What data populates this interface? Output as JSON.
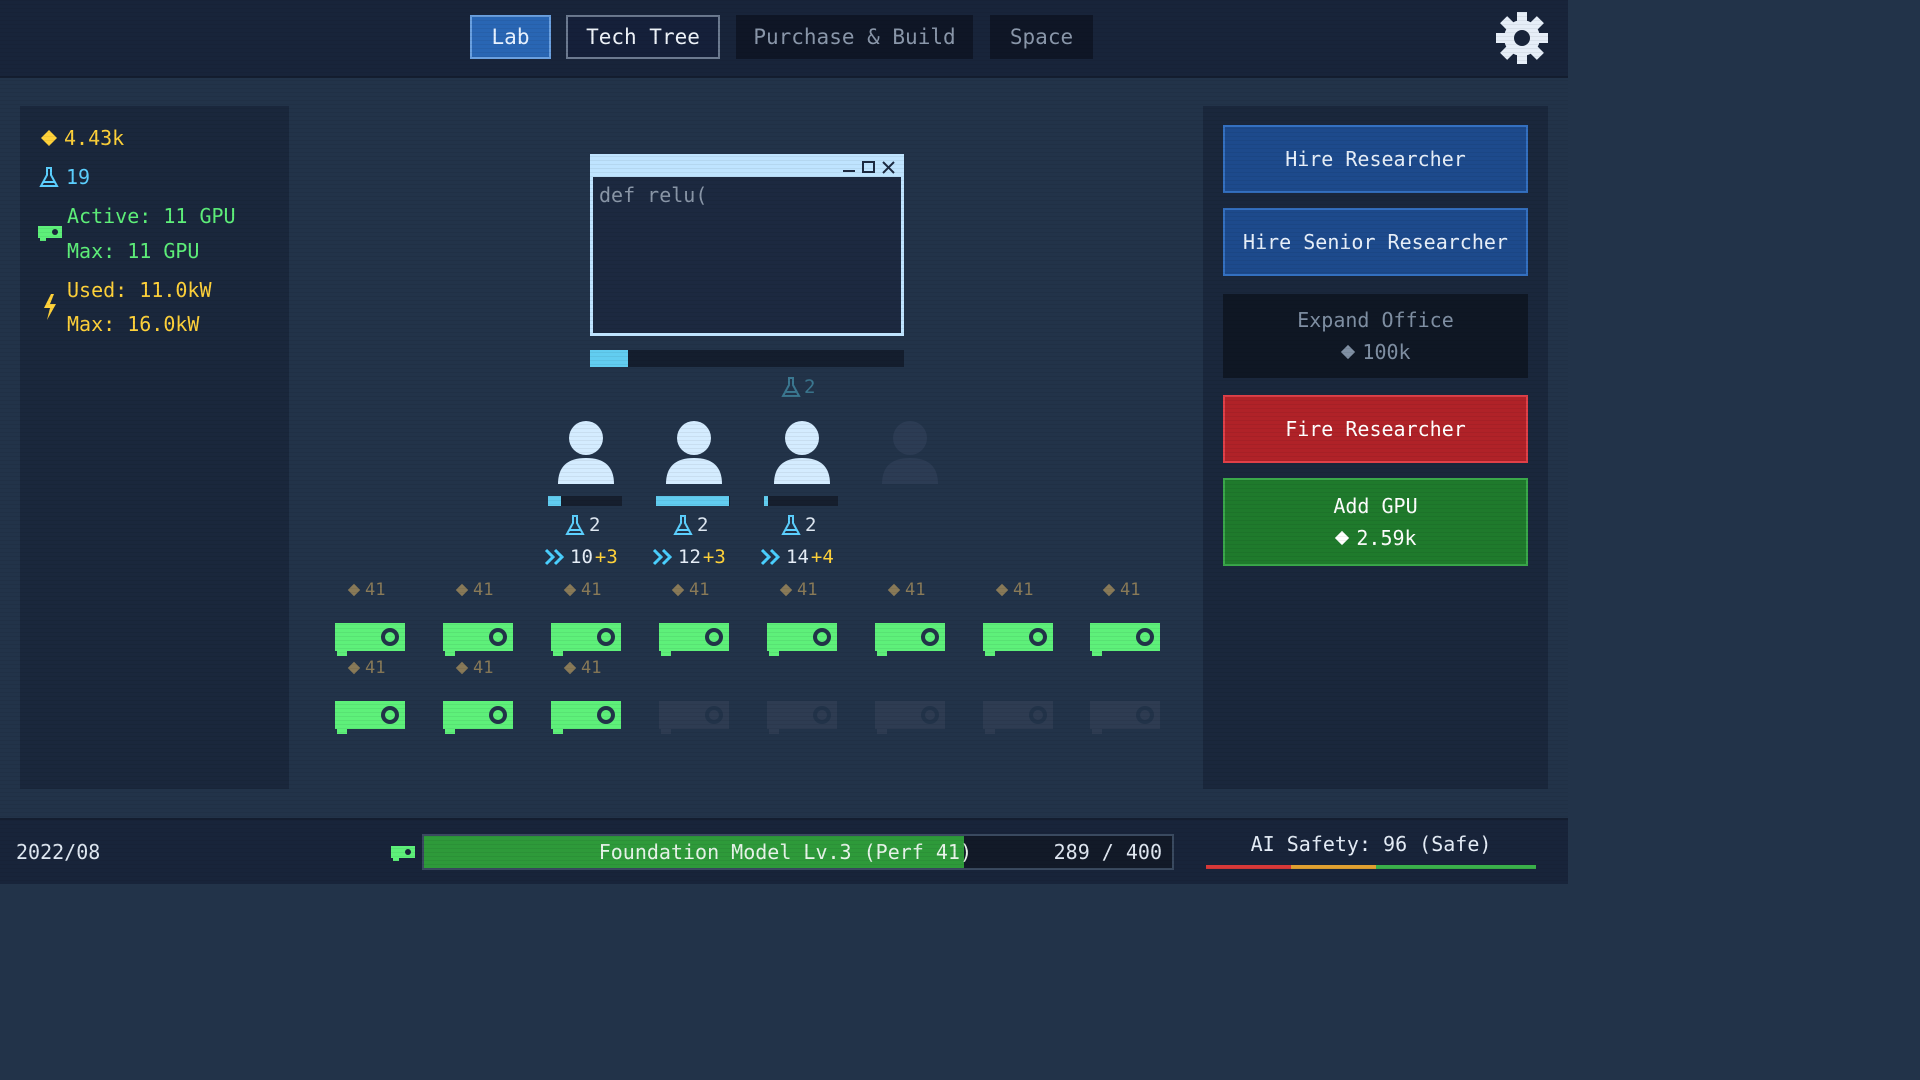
{
  "tabs": [
    {
      "label": "Lab",
      "state": "active"
    },
    {
      "label": "Tech Tree",
      "state": "normal"
    },
    {
      "label": "Purchase & Build",
      "state": "dim"
    },
    {
      "label": "Space",
      "state": "dim"
    }
  ],
  "icons": {
    "settings": "gear-icon",
    "money": "diamond-icon",
    "science": "flask-icon",
    "gpu": "gpu-icon",
    "power": "lightning-icon",
    "speed": "double-chevron-icon"
  },
  "stats": {
    "money": "4.43k",
    "science": "19",
    "gpu_active": "Active: 11 GPU",
    "gpu_max": "Max: 11 GPU",
    "power_used": "Used: 11.0kW",
    "power_max": "Max: 16.0kW"
  },
  "actions": {
    "hire": "Hire Researcher",
    "hire_senior": "Hire Senior Researcher",
    "expand": {
      "label": "Expand Office",
      "cost": "100k"
    },
    "fire": "Fire Researcher",
    "add_gpu": {
      "label": "Add GPU",
      "cost": "2.59k"
    }
  },
  "code_window": {
    "text": "def relu(",
    "progress": 0.12
  },
  "lab_science_rate": "2",
  "researchers": [
    {
      "science": "2",
      "speed_base": "10",
      "speed_bonus": "+3",
      "progress": 0.18,
      "active": true
    },
    {
      "science": "2",
      "speed_base": "12",
      "speed_bonus": "+3",
      "progress": 0.98,
      "active": true
    },
    {
      "science": "2",
      "speed_base": "14",
      "speed_bonus": "+4",
      "progress": 0.05,
      "active": true
    },
    {
      "active": false
    }
  ],
  "gpus": {
    "row1": [
      {
        "label": "41",
        "active": true
      },
      {
        "label": "41",
        "active": true
      },
      {
        "label": "41",
        "active": true
      },
      {
        "label": "41",
        "active": true
      },
      {
        "label": "41",
        "active": true
      },
      {
        "label": "41",
        "active": true
      },
      {
        "label": "41",
        "active": true
      },
      {
        "label": "41",
        "active": true
      }
    ],
    "row2": [
      {
        "label": "41",
        "active": true
      },
      {
        "label": "41",
        "active": true
      },
      {
        "label": "41",
        "active": true
      },
      {
        "active": false
      },
      {
        "active": false
      },
      {
        "active": false
      },
      {
        "active": false
      },
      {
        "active": false
      }
    ]
  },
  "bottom": {
    "date": "2022/08",
    "model_label": "Foundation Model Lv.3 (Perf 41)",
    "model_progress": 0.7225,
    "model_count": "289 / 400",
    "safety": "AI Safety: 96 (Safe)"
  },
  "colors": {
    "accent": "#2966b4",
    "money": "#ffd23a",
    "science": "#5cd0ff",
    "gpu": "#5ef07a",
    "gpu_off": "#2e3c52",
    "danger": "#b02228",
    "success": "#1f7a2c"
  }
}
